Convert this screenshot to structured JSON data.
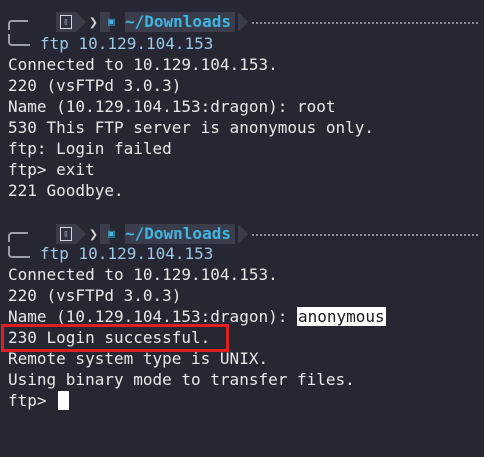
{
  "blocks": [
    {
      "prompt": {
        "os_icon": "terminal-icon",
        "folder_icon": "folder-icon",
        "directory": "~/Downloads",
        "command": "ftp 10.129.104.153"
      },
      "lines": [
        "Connected to 10.129.104.153.",
        "220 (vsFTPd 3.0.3)",
        "Name (10.129.104.153:dragon): root",
        "530 This FTP server is anonymous only.",
        "ftp: Login failed",
        "ftp> exit",
        "221 Goodbye."
      ]
    },
    {
      "prompt": {
        "os_icon": "terminal-icon",
        "folder_icon": "folder-icon",
        "directory": "~/Downloads",
        "command": "ftp 10.129.104.153"
      },
      "lines": [
        "Connected to 10.129.104.153.",
        "220 (vsFTPd 3.0.3)"
      ],
      "name_prompt": "Name (10.129.104.153:dragon): ",
      "name_input": "anonymous",
      "highlighted_line": "230 Login successful.",
      "after_lines": [
        "Remote system type is UNIX.",
        "Using binary mode to transfer files."
      ],
      "final_prompt": "ftp> "
    }
  ],
  "colors": {
    "background": "#262733",
    "directory": "#3fb5e6",
    "highlight_border": "#e02020"
  }
}
